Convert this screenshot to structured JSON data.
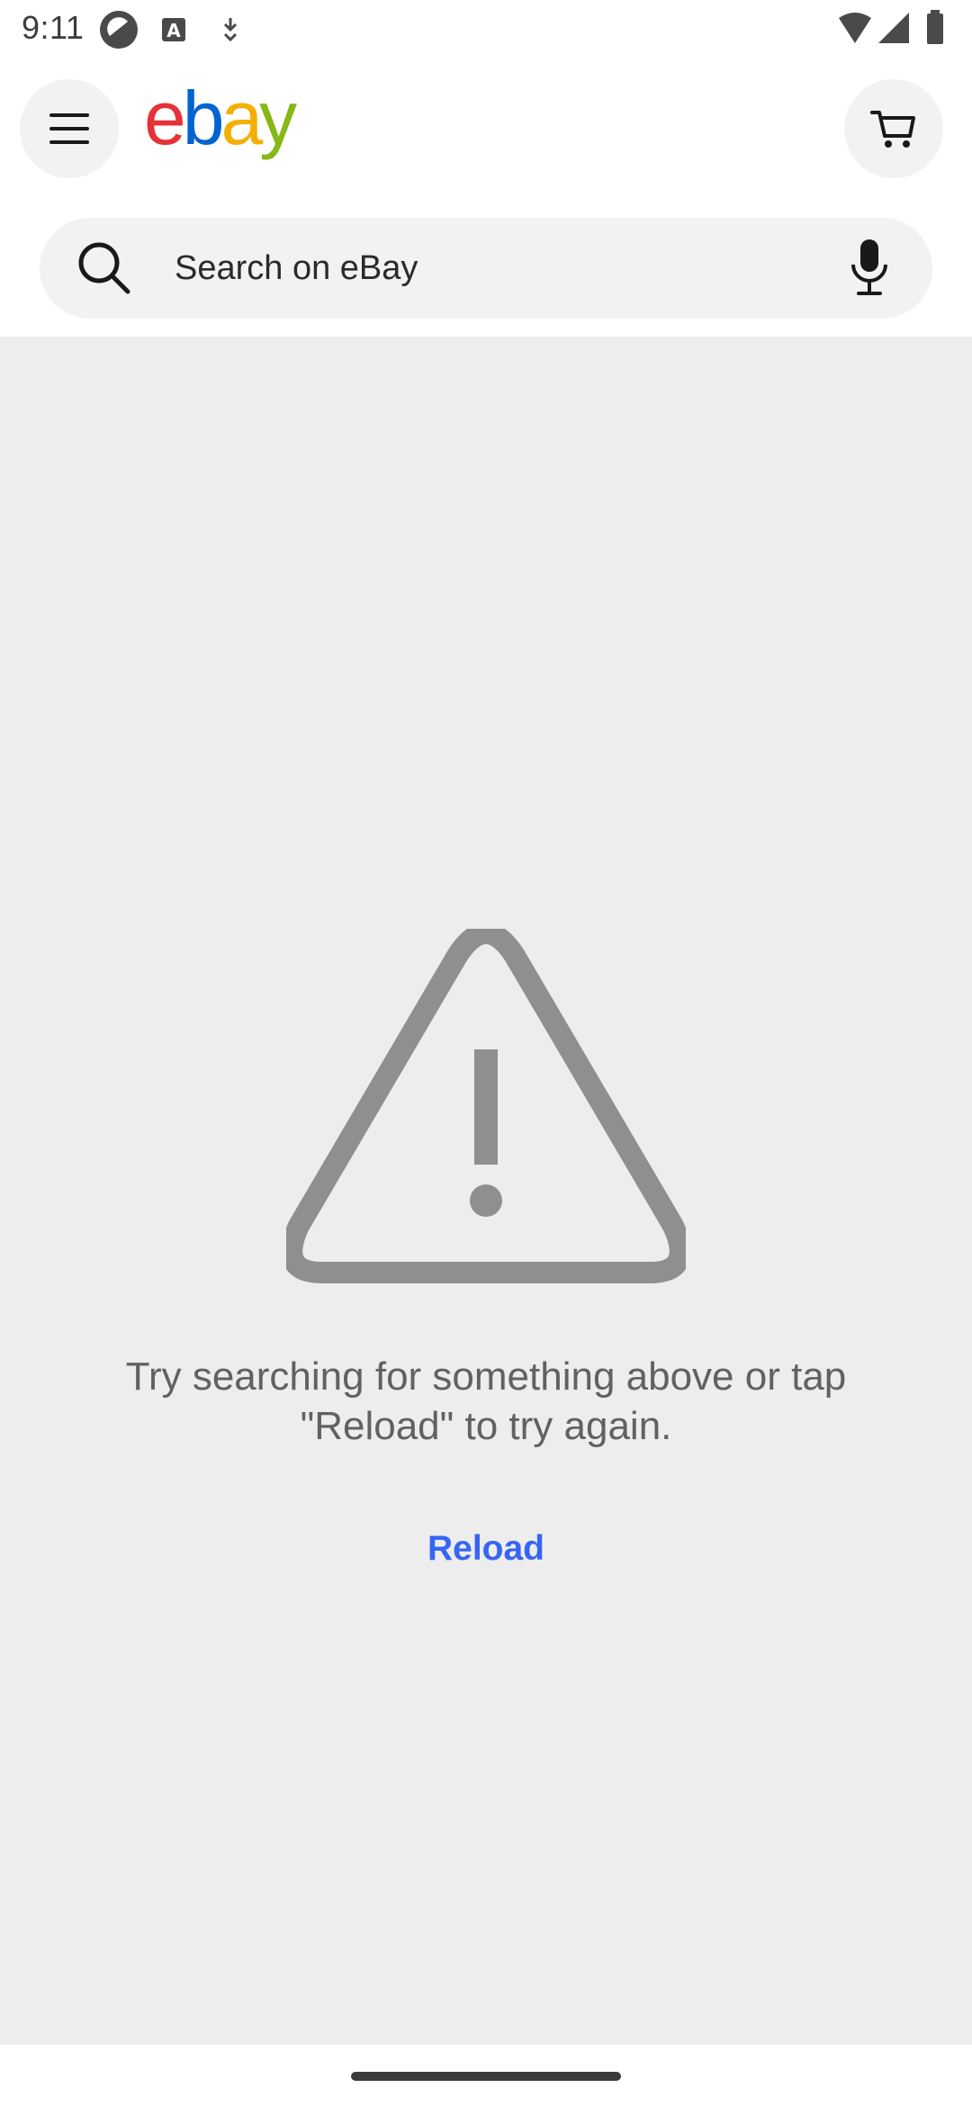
{
  "status_bar": {
    "time": "9:11",
    "left_icons": [
      "app-notification-icon",
      "text-a-icon",
      "download-icon"
    ],
    "right_icons": [
      "wifi-icon",
      "cellular-signal-icon",
      "battery-icon"
    ]
  },
  "header": {
    "logo_text": "ebay",
    "logo_colors": [
      "#e53238",
      "#0064d2",
      "#f5af02",
      "#86b817"
    ],
    "menu_icon": "hamburger-menu-icon",
    "cart_icon": "shopping-cart-icon"
  },
  "search": {
    "placeholder": "Search on eBay",
    "search_icon": "search-icon",
    "mic_icon": "microphone-icon"
  },
  "error": {
    "icon": "warning-triangle-icon",
    "icon_color": "#8f8f8f",
    "message": "Try searching for something above or tap \"Reload\" to try again.",
    "reload_label": "Reload",
    "reload_color": "#3665f3"
  },
  "colors": {
    "content_background": "#ededed",
    "header_background": "#ffffff",
    "search_background": "#f2f2f2"
  }
}
